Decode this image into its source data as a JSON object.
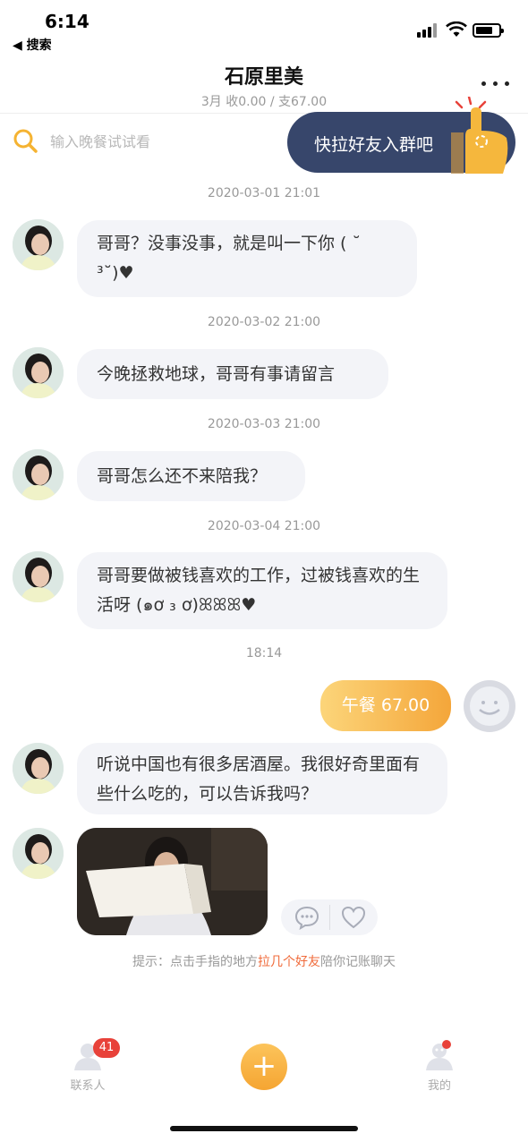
{
  "status_bar": {
    "time": "6:14",
    "back_app": "◀ 搜索"
  },
  "header": {
    "title": "石原里美",
    "subtitle": "3月 收0.00 / 支67.00"
  },
  "search": {
    "placeholder": "输入晚餐试试看"
  },
  "invite": {
    "label": "快拉好友入群吧"
  },
  "messages": [
    {
      "time": "2020-03-01 21:01",
      "text": "哥哥？没事没事，就是叫一下你 ( ˘ ³˘)♥"
    },
    {
      "time": "2020-03-02 21:00",
      "text": "今晚拯救地球，哥哥有事请留言"
    },
    {
      "time": "2020-03-03 21:00",
      "text": "哥哥怎么还不来陪我？"
    },
    {
      "time": "2020-03-04 21:00",
      "text": "哥哥要做被钱喜欢的工作，过被钱喜欢的生活呀 (๑ơ ₃ ơ)ꕤꕤꕤ♥"
    },
    {
      "time": "18:14"
    }
  ],
  "outgoing": {
    "label": "午餐 67.00"
  },
  "incoming_question": "听说中国也有很多居酒屋。我很好奇里面有些什么吃的，可以告诉我吗？",
  "hint": {
    "prefix": "提示：点击手指的地方",
    "highlight": "拉几个好友",
    "suffix": "陪你记账聊天"
  },
  "tabs": {
    "contacts_label": "联系人",
    "contacts_badge": "41",
    "mine_label": "我的",
    "add_symbol": "+"
  },
  "icons": [
    "search-icon",
    "more-icon",
    "finger-icon",
    "comment-icon",
    "heart-icon",
    "contacts-icon",
    "profile-icon",
    "plus-icon"
  ],
  "colors": {
    "accent_orange": "#f5a532",
    "invite_bg": "#37466b",
    "badge_red": "#e8423a",
    "highlight": "#f06b3b"
  }
}
